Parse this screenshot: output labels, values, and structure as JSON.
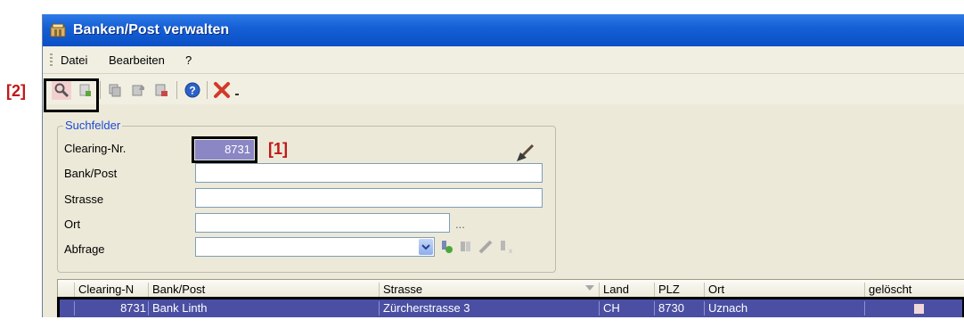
{
  "window": {
    "title": "Banken/Post verwalten"
  },
  "menu": [
    "Datei",
    "Bearbeiten",
    "?"
  ],
  "toolbar": {
    "buttons": [
      "search-icon",
      "new-icon",
      "copy-icon",
      "edit-icon",
      "delete-icon",
      "help-icon",
      "close-icon"
    ]
  },
  "search": {
    "legend": "Suchfelder",
    "fields": {
      "clearing": {
        "label": "Clearing-Nr.",
        "value": "8731"
      },
      "bank": {
        "label": "Bank/Post",
        "value": ""
      },
      "strasse": {
        "label": "Strasse",
        "value": ""
      },
      "ort": {
        "label": "Ort",
        "value": "",
        "ellipsis": "..."
      },
      "abfrage": {
        "label": "Abfrage",
        "value": ""
      }
    }
  },
  "grid": {
    "columns": [
      "Clearing-N",
      "Bank/Post",
      "Strasse",
      "Land",
      "PLZ",
      "Ort",
      "gelöscht"
    ],
    "rows": [
      {
        "clearing": "8731",
        "bank": "Bank Linth",
        "strasse": "Zürcherstrasse 3",
        "land": "CH",
        "plz": "8730",
        "ort": "Uznach",
        "geloescht": false
      }
    ]
  },
  "annotations": {
    "label1": "[1]",
    "label2": "[2]"
  },
  "colors": {
    "title_bar": "#0a4fc6",
    "selection": "#4a4fa3",
    "legend": "#1c4ad8",
    "annotation": "#c01818"
  }
}
